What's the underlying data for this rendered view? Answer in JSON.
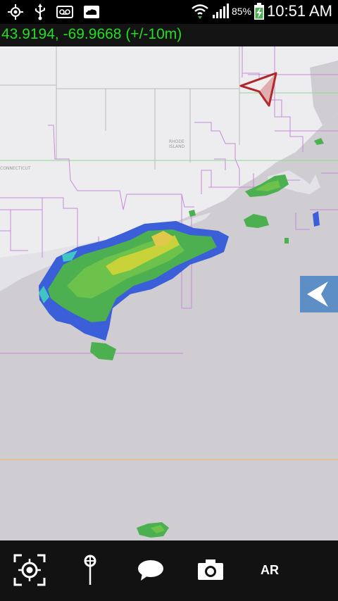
{
  "status_bar": {
    "icons": [
      "gps-icon",
      "usb-icon",
      "voicemail-icon",
      "weather-cloud-icon",
      "wifi-icon",
      "signal-icon",
      "battery-charging-icon"
    ],
    "battery_percent": "85%",
    "time": "10:51 AM"
  },
  "location": {
    "coordinates_text": "43.9194, -69.9668 (+/-10m)"
  },
  "map": {
    "place_labels": [
      "RHODE ISLAND",
      "CONNECTICUT"
    ],
    "compass": "compass-arrow-icon",
    "side_tab": "chevron-left-icon"
  },
  "toolbar": {
    "items": [
      {
        "icon": "locate-target-icon"
      },
      {
        "icon": "map-pin-icon"
      },
      {
        "icon": "chat-bubble-icon"
      },
      {
        "icon": "camera-icon"
      },
      {
        "label": "AR"
      }
    ]
  },
  "colors": {
    "map_land": "#ededef",
    "map_water": "#cfcdd2",
    "boundary": "#c58ad9",
    "coords_text": "#22dd22",
    "radar_light": "#4caf50",
    "radar_strong": "#c8d33a",
    "radar_cool": "#3a5fd8",
    "side_tab": "#5d8ec6"
  }
}
